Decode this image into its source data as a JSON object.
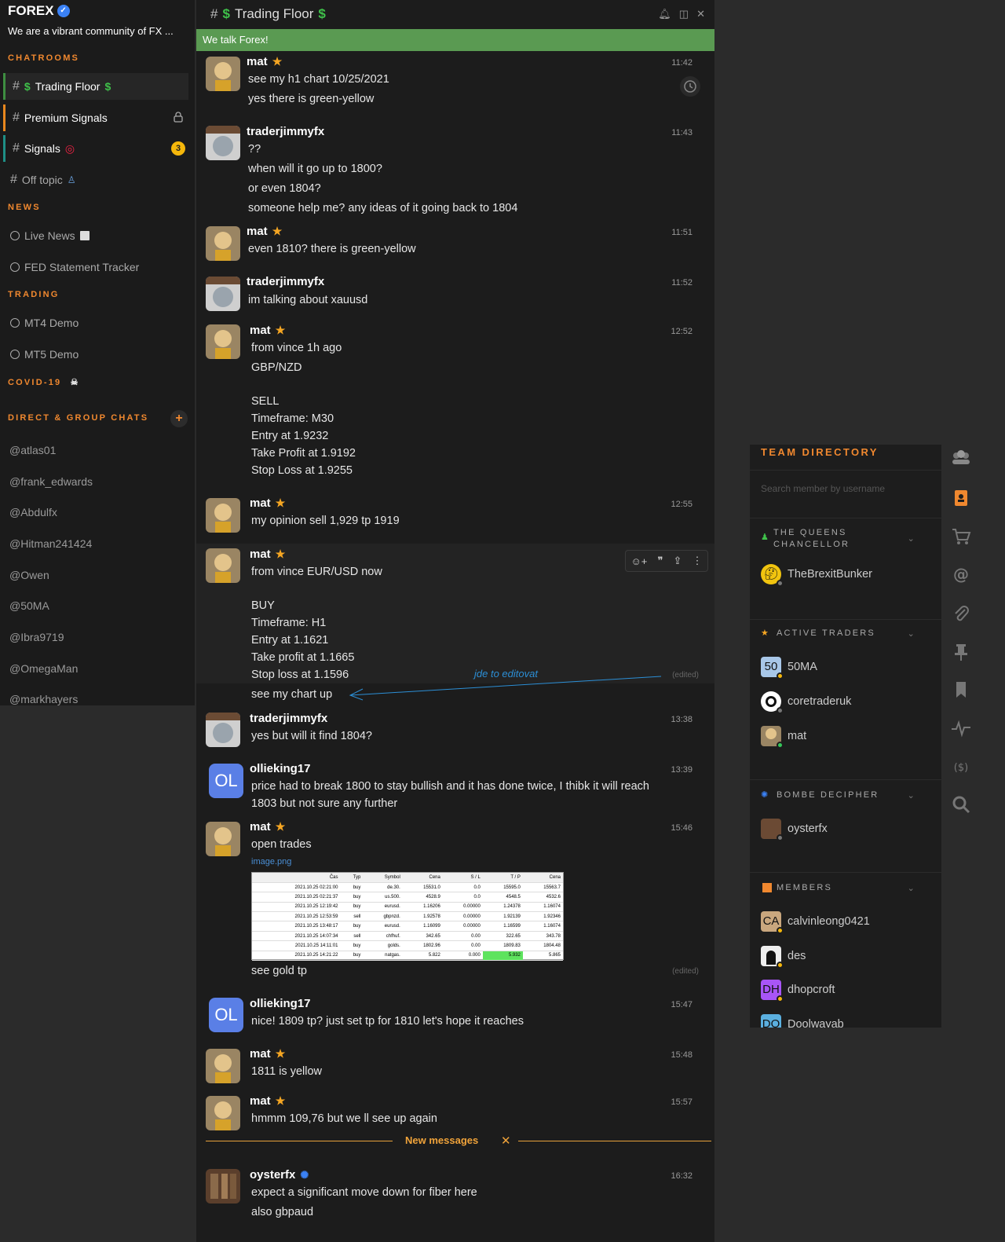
{
  "server": {
    "name": "FOREX",
    "tagline": "We are a vibrant community of FX ..."
  },
  "sidebar": {
    "sections": {
      "chatrooms": "CHATROOMS",
      "news": "NEWS",
      "trading": "TRADING",
      "covid": "COVID-19",
      "direct": "DIRECT & GROUP CHATS"
    },
    "channels": [
      {
        "label": "Trading Floor"
      },
      {
        "label": "Premium Signals"
      },
      {
        "label": "Signals",
        "badge": "3"
      },
      {
        "label": "Off topic"
      },
      {
        "label": "Live News"
      },
      {
        "label": "FED Statement Tracker"
      },
      {
        "label": "MT4 Demo"
      },
      {
        "label": "MT5 Demo"
      }
    ],
    "dms": [
      "@atlas01",
      "@frank_edwards",
      "@Abdulfx",
      "@Hitman241424",
      "@Owen",
      "@50MA",
      "@Ibra9719",
      "@OmegaMan",
      "@markhayers"
    ]
  },
  "chat": {
    "title": "Trading Floor",
    "topic": "We talk Forex!",
    "messages": [
      {
        "author": "mat",
        "time": "11:42",
        "lines": [
          "see my h1 chart 10/25/2021",
          "yes there is green-yellow"
        ]
      },
      {
        "author": "traderjimmyfx",
        "time": "11:43",
        "lines": [
          "??",
          "when will it go up to 1800?",
          "or even 1804?",
          "someone help me? any ideas of it going back to 1804"
        ]
      },
      {
        "author": "mat",
        "time": "11:51",
        "lines": [
          "even 1810? there is green-yellow"
        ]
      },
      {
        "author": "traderjimmyfx",
        "time": "11:52",
        "lines": [
          "im talking about xauusd"
        ]
      },
      {
        "author": "mat",
        "time": "12:52",
        "lines": [
          "from vince 1h ago",
          "GBP/NZD",
          "SELL",
          "Timeframe: M30",
          "Entry at 1.9232",
          "Take Profit at 1.9192",
          "Stop Loss at 1.9255"
        ]
      },
      {
        "author": "mat",
        "time": "12:55",
        "lines": [
          "my opinion sell 1,929 tp 1919"
        ]
      },
      {
        "author": "mat",
        "lines": [
          "from vince EUR/USD now",
          "BUY",
          "Timeframe: H1",
          "Entry at 1.1621",
          "Take profit at 1.1665",
          "Stop loss at 1.1596",
          "see my chart up"
        ],
        "edited": "(edited)"
      },
      {
        "author": "traderjimmyfx",
        "time": "13:38",
        "lines": [
          "yes but will it find 1804?"
        ]
      },
      {
        "author": "ollieking17",
        "avatar": "OL",
        "time": "13:39",
        "lines": [
          "price had to break 1800 to stay bullish and it has done twice, I thibk it will reach",
          "1803 but not sure any further"
        ]
      },
      {
        "author": "mat",
        "time": "15:46",
        "lines": [
          "open trades",
          "see gold tp"
        ],
        "attachment": "image.png",
        "edited": "(edited)"
      },
      {
        "author": "ollieking17",
        "avatar": "OL",
        "time": "15:47",
        "lines": [
          "nice! 1809 tp? just set tp for 1810 let's hope it reaches"
        ]
      },
      {
        "author": "mat",
        "time": "15:48",
        "lines": [
          "1811 is yellow"
        ]
      },
      {
        "author": "mat",
        "time": "15:57",
        "lines": [
          "hmmm 109,76 but we ll see up again"
        ]
      },
      {
        "author": "oysterfx",
        "time": "16:32",
        "lines": [
          "expect a significant move down for fiber here",
          "also gbpaud"
        ]
      }
    ],
    "annotation": "jde to editovat",
    "new_messages": "New messages",
    "trades_table": {
      "headers": [
        "Čas",
        "Typ",
        "Symbol",
        "Cena",
        "S / L",
        "T / P",
        "Cena"
      ],
      "rows": [
        [
          "2021.10.25 02:21:00",
          "buy",
          "de.30.",
          "15531.0",
          "0.0",
          "15595.0",
          "15563.7"
        ],
        [
          "2021.10.25 02:21:37",
          "buy",
          "us.500.",
          "4528.9",
          "0.0",
          "4548.5",
          "4532.6"
        ],
        [
          "2021.10.25 12:19:42",
          "buy",
          "eurusd.",
          "1.16206",
          "0.00000",
          "1.24378",
          "1.16074"
        ],
        [
          "2021.10.25 12:53:59",
          "sell",
          "gbpnzd.",
          "1.92578",
          "0.00000",
          "1.92139",
          "1.92346"
        ],
        [
          "2021.10.25 13:48:17",
          "buy",
          "eurusd.",
          "1.16099",
          "0.00000",
          "1.16599",
          "1.16074"
        ],
        [
          "2021.10.25 14:07:34",
          "sell",
          "chfhuf.",
          "342.65",
          "0.00",
          "322.65",
          "343.78"
        ],
        [
          "2021.10.25 14:11:01",
          "buy",
          "golds.",
          "1802.96",
          "0.00",
          "1809.83",
          "1804.48"
        ],
        [
          "2021.10.25 14:21:22",
          "buy",
          "natgas.",
          "5.822",
          "0.000",
          "5.932",
          "5.865"
        ]
      ]
    }
  },
  "directory": {
    "title": "TEAM DIRECTORY",
    "search_placeholder": "Search member by username",
    "groups": {
      "queens": "THE QUEENS CHANCELLOR",
      "active": "ACTIVE TRADERS",
      "bombe": "BOMBE DECIPHER",
      "members": "MEMBERS"
    },
    "members": {
      "queens": [
        "TheBrexitBunker"
      ],
      "active": [
        {
          "name": "50MA",
          "initials": "50"
        },
        {
          "name": "coretraderuk"
        },
        {
          "name": "mat"
        }
      ],
      "bombe": [
        "oysterfx"
      ],
      "members": [
        {
          "name": "calvinleong0421",
          "initials": "CA"
        },
        {
          "name": "des"
        },
        {
          "name": "dhopcroft",
          "initials": "DH"
        },
        {
          "name": "Doolwayab",
          "initials": "DO"
        }
      ]
    }
  },
  "colors": {
    "accent": "#f0882f",
    "topic": "#5a9a52",
    "star": "#f5a623",
    "online": "#34c759",
    "away": "#f5b70b"
  }
}
